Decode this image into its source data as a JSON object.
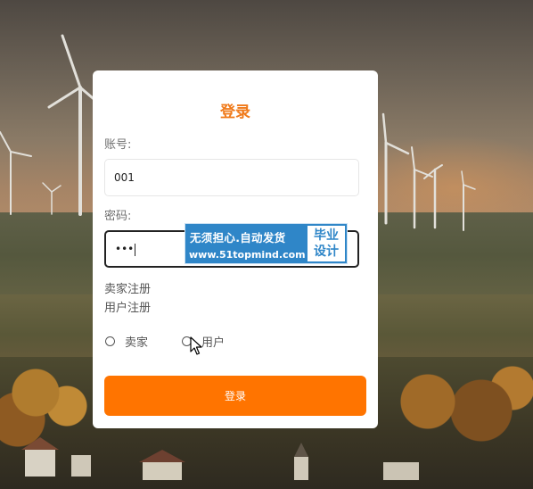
{
  "login": {
    "title": "登录",
    "account_label": "账号:",
    "account_value": "001",
    "password_label": "密码:",
    "password_value": "•••",
    "seller_register_link": "卖家注册",
    "user_register_link": "用户注册",
    "role_options": [
      "卖家",
      "用户"
    ],
    "submit_label": "登录"
  },
  "watermark": {
    "line1": "无须担心.自动发货",
    "line2": "www.51topmind.com",
    "badge_line1": "毕业",
    "badge_line2": "设计"
  },
  "colors": {
    "accent": "#ff7400",
    "title": "#f07a1a",
    "watermark": "#2f86c8"
  },
  "icons": {
    "cursor": "arrow-cursor-icon"
  }
}
